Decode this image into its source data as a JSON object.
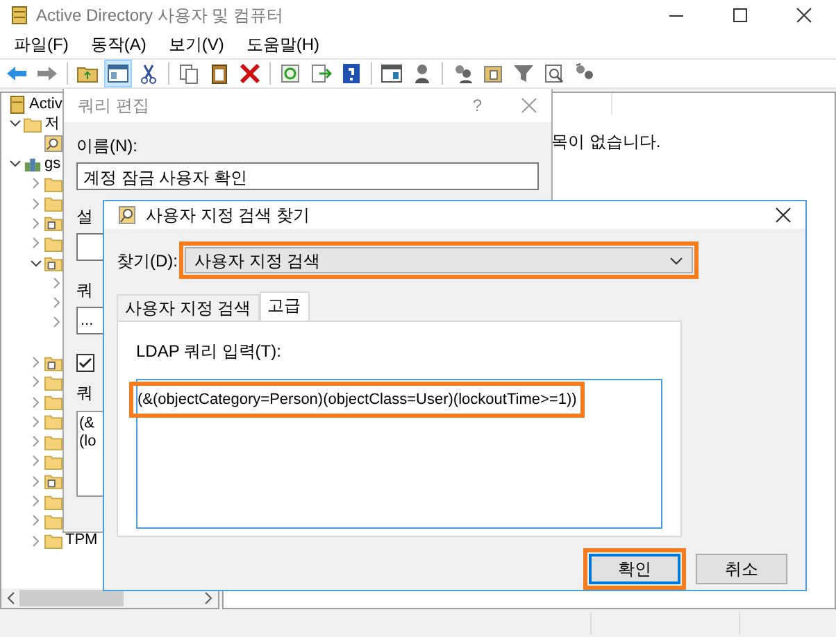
{
  "window": {
    "title": "Active Directory 사용자 및 컴퓨터"
  },
  "menu": [
    "파일(F)",
    "동작(A)",
    "보기(V)",
    "도움말(H)"
  ],
  "toolbar": [
    {
      "selected": false
    },
    {
      "selected": false
    },
    {
      "selected": false
    },
    {
      "selected": true
    },
    {
      "selected": false
    },
    {
      "selected": false
    },
    {
      "selected": false
    },
    {
      "selected": false
    },
    {
      "selected": false
    },
    {
      "selected": false
    },
    {
      "selected": false
    },
    {
      "selected": false
    },
    {
      "selected": false
    },
    {
      "selected": false
    },
    {
      "selected": false
    },
    {
      "selected": false
    },
    {
      "selected": false
    },
    {
      "selected": false
    }
  ],
  "tree": [
    {
      "kind": "root",
      "label": "Activ",
      "children": [
        {
          "kind": "folder",
          "label": "저",
          "expanded": true,
          "children": [
            {
              "kind": "query"
            }
          ]
        },
        {
          "kind": "domain",
          "label": "gs",
          "expanded": true,
          "children": [
            {
              "kind": "folder",
              "expanded": false
            },
            {
              "kind": "folder",
              "expanded": false
            },
            {
              "kind": "ou",
              "expanded": false
            },
            {
              "kind": "folder",
              "expanded": false
            },
            {
              "kind": "ou",
              "expanded": true,
              "children": [
                {
                  "kind": "branch",
                  "expanded": false
                },
                {
                  "kind": "branch",
                  "expanded": false
                },
                {
                  "kind": "branch",
                  "expanded": false
                },
                {
                  "kind": "leaf"
                }
              ]
            },
            {
              "kind": "ou",
              "expanded": false
            },
            {
              "kind": "folder",
              "expanded": false
            },
            {
              "kind": "folder",
              "expanded": false
            },
            {
              "kind": "folder",
              "expanded": false
            },
            {
              "kind": "folder",
              "expanded": false
            },
            {
              "kind": "folder",
              "expanded": false
            },
            {
              "kind": "ou",
              "expanded": false
            },
            {
              "kind": "folder",
              "expanded": false
            },
            {
              "kind": "folder",
              "expanded": false
            },
            {
              "kind": "folder",
              "label": "TPM",
              "expanded": false
            }
          ]
        }
      ]
    }
  ],
  "right_pane": {
    "message": "목이 없습니다."
  },
  "query_edit": {
    "title": "쿼리 편집",
    "help": "?",
    "name_label": "이름(N):",
    "name_value": "계정 잠금 사용자 확인",
    "description_label": "설",
    "query_label": "쿼",
    "query_root": "...",
    "include_checkbox": {
      "checked": true
    },
    "query_string_label": "쿼",
    "query_string_lines": [
      "(&",
      "(lo"
    ]
  },
  "find_dialog": {
    "title": "사용자 지정 검색 찾기",
    "find_label": "찾기(D):",
    "find_value": "사용자 지정 검색",
    "find_highlighted": true,
    "tabs": [
      {
        "label": "사용자 지정 검색",
        "selected": false
      },
      {
        "label": "고급",
        "selected": true
      }
    ],
    "ldap_label": "LDAP 쿼리 입력(T):",
    "ldap_query": "(&(objectCategory=Person)(objectClass=User)(lockoutTime>=1))",
    "ldap_highlighted": true,
    "buttons": [
      {
        "label": "확인",
        "highlighted": true
      },
      {
        "label": "취소",
        "highlighted": false
      }
    ]
  }
}
